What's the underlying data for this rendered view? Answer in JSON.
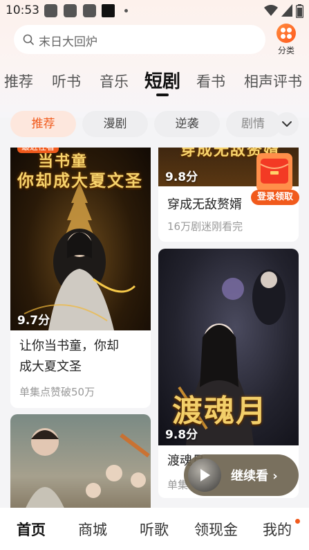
{
  "status_bar": {
    "time": "10:53"
  },
  "search": {
    "placeholder": "末日大回炉"
  },
  "category_button": {
    "label": "分类"
  },
  "tabs": [
    {
      "label": "推荐"
    },
    {
      "label": "听书"
    },
    {
      "label": "音乐"
    },
    {
      "label": "短剧"
    },
    {
      "label": "看书"
    },
    {
      "label": "相声评书"
    }
  ],
  "chips": [
    {
      "label": "推荐"
    },
    {
      "label": "漫剧"
    },
    {
      "label": "逆袭"
    },
    {
      "label": "剧情"
    }
  ],
  "cards": [
    {
      "badge": "最近在看",
      "cover_title_1": "当书童",
      "cover_title_2": "你却成大夏文圣",
      "rating": "9.7分",
      "title_line_1": "让你当书童，你却",
      "title_line_2": "成大夏文圣",
      "subtitle": "单集点赞破50万"
    },
    {
      "cover_title": "穿成无敌赘婿",
      "rating": "9.8分",
      "title": "穿成无敌赘婿",
      "subtitle": "16万剧迷刚看完"
    },
    {
      "cover_title": "渡魂月",
      "rating": "9.8分",
      "title": "渡魂月",
      "subtitle": "单集"
    },
    {}
  ],
  "coupon": {
    "label": "登录领取"
  },
  "continue_watching": {
    "label": "继续看 ›"
  },
  "bottom_nav": [
    {
      "label": "首页"
    },
    {
      "label": "商城"
    },
    {
      "label": "听歌"
    },
    {
      "label": "领现金"
    },
    {
      "label": "我的"
    }
  ],
  "colors": {
    "accent": "#f15a1c",
    "chip_active_bg": "#fde7dd"
  }
}
